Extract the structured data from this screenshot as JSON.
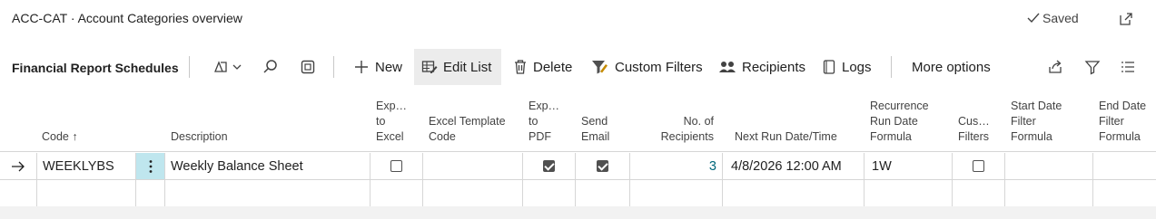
{
  "header": {
    "title": "ACC-CAT · Account Categories overview",
    "saved_label": "Saved"
  },
  "actionbar": {
    "page_name": "Financial Report Schedules",
    "new_label": "New",
    "edit_list_label": "Edit List",
    "delete_label": "Delete",
    "custom_filters_label": "Custom Filters",
    "recipients_label": "Recipients",
    "logs_label": "Logs",
    "more_options_label": "More options"
  },
  "columns": {
    "code": "Code ↑",
    "description": "Description",
    "export_excel": "Exp…\nto\nExcel",
    "excel_template": "Excel Template\nCode",
    "export_pdf": "Exp…\nto\nPDF",
    "send_email": "Send\nEmail",
    "no_recipients": "No. of\nRecipients",
    "next_run": "Next Run Date/Time",
    "recurrence": "Recurrence\nRun Date\nFormula",
    "custom_filters": "Cus…\nFilters",
    "start_date": "Start Date\nFilter\nFormula",
    "end_date": "End Date\nFilter\nFormula"
  },
  "rows": [
    {
      "code": "WEEKLYBS",
      "description": "Weekly Balance Sheet",
      "export_excel": false,
      "excel_template": "",
      "export_pdf": true,
      "send_email": true,
      "no_recipients": "3",
      "next_run": "4/8/2026 12:00 AM",
      "recurrence": "1W",
      "custom_filters": false,
      "start_date": "",
      "end_date": ""
    }
  ],
  "colors": {
    "accent": "#00677a",
    "selected_row_marker": "#bfe6ee",
    "active_action_bg": "#ececec"
  }
}
